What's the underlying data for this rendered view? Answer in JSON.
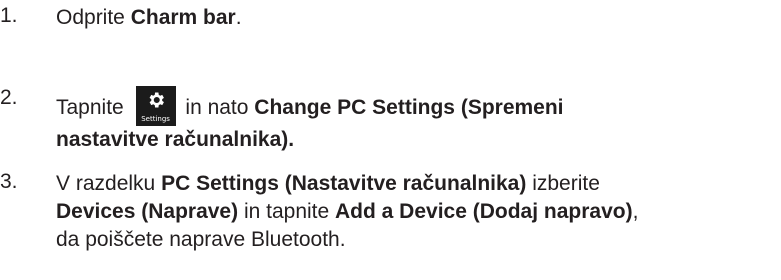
{
  "steps": [
    {
      "number": "1.",
      "t1": "Odprite ",
      "b1": "Charm bar",
      "t2": "."
    },
    {
      "number": "2.",
      "t1": "Tapnite ",
      "icon_caption": "Settings",
      "t2": " in nato ",
      "b1": "Change PC Settings (Spremeni",
      "b2": "nastavitve računalnika)."
    },
    {
      "number": "3.",
      "t1": "V razdelku ",
      "b1": "PC Settings (Nastavitve računalnika)",
      "t2": " izberite",
      "b2": "Devices (Naprave)",
      "t3": " in tapnite ",
      "b3": "Add a Device (Dodaj napravo)",
      "t4": ",",
      "t5": "da poiščete naprave Bluetooth."
    }
  ],
  "icons": {
    "settings": "gear-icon"
  },
  "colors": {
    "text": "#231f20",
    "icon_bg": "#1b1b1b"
  }
}
